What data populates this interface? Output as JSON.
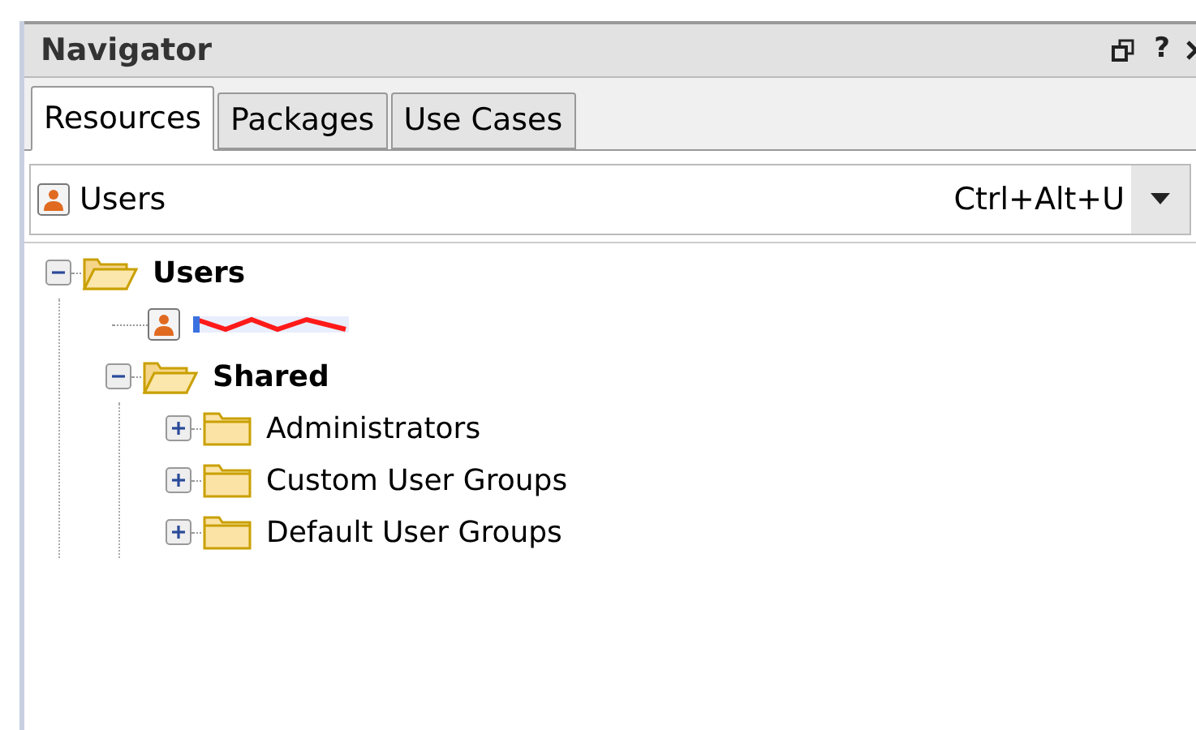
{
  "panel": {
    "title": "Navigator",
    "help": "?"
  },
  "tabs": [
    {
      "label": "Resources",
      "selected": true
    },
    {
      "label": "Packages",
      "selected": false
    },
    {
      "label": "Use Cases",
      "selected": false
    }
  ],
  "selector": {
    "value": "Users",
    "shortcut": "Ctrl+Alt+U"
  },
  "tree": [
    {
      "kind": "folder",
      "label": "Users",
      "bold": true,
      "expanded": true,
      "children": [
        {
          "kind": "user",
          "redacted": true
        },
        {
          "kind": "folder",
          "label": "Shared",
          "bold": true,
          "expanded": true,
          "children": [
            {
              "kind": "folder",
              "label": "Administrators",
              "bold": false,
              "expanded": false
            },
            {
              "kind": "folder",
              "label": "Custom User Groups",
              "bold": false,
              "expanded": false
            },
            {
              "kind": "folder",
              "label": "Default User Groups",
              "bold": false,
              "expanded": false
            }
          ]
        }
      ]
    }
  ]
}
